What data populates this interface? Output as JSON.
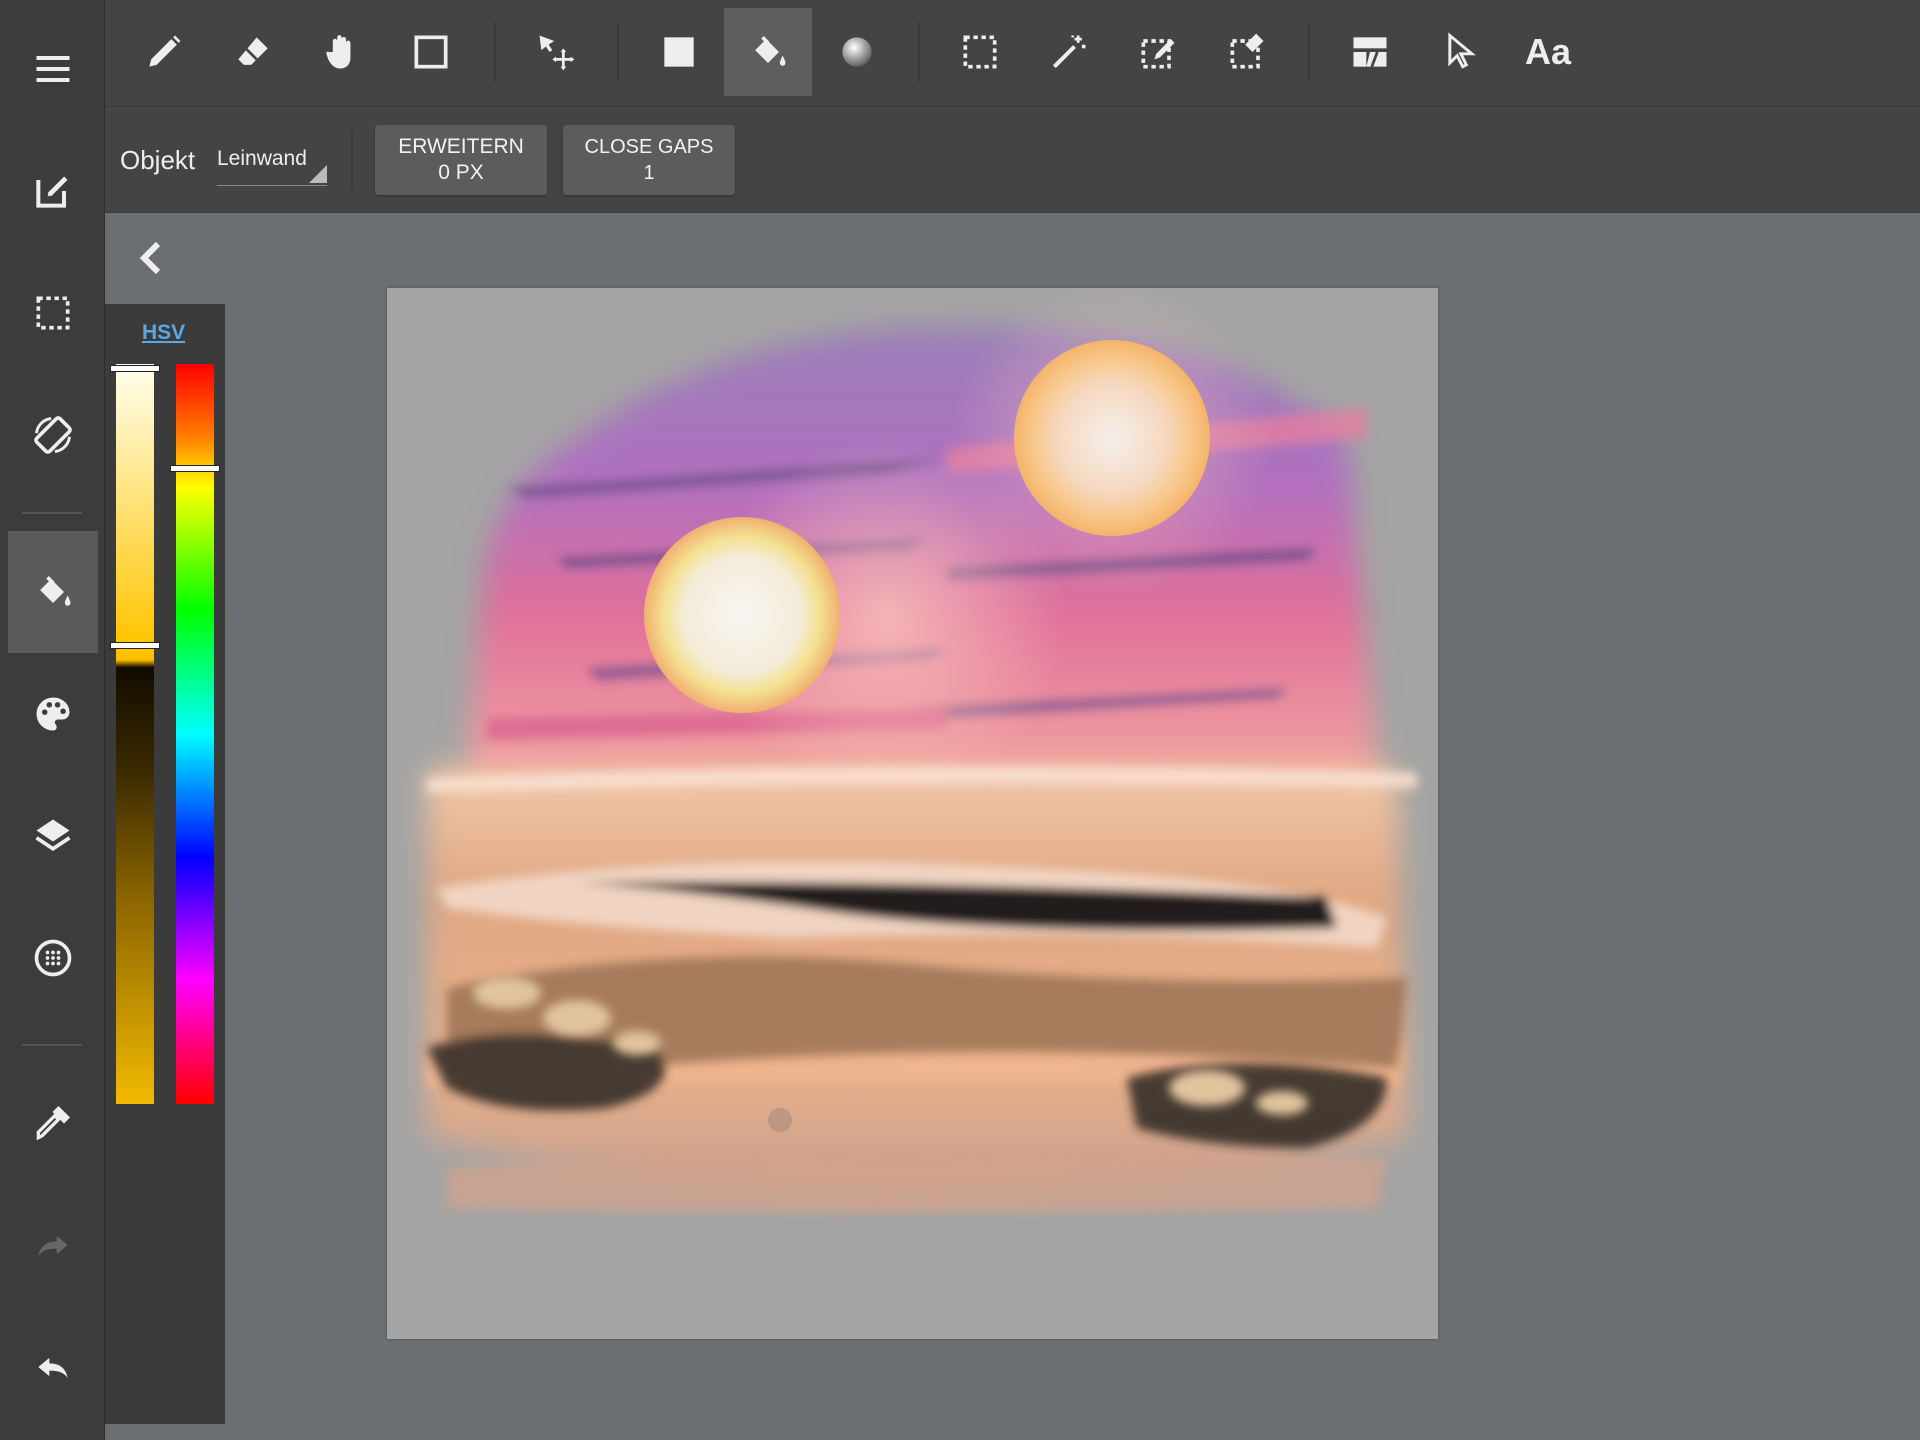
{
  "app": {
    "accent_color": "#5aa8e8",
    "active_tool_bg": "#5e5e5e"
  },
  "sidebar": {
    "items": [
      {
        "name": "menu-icon"
      },
      {
        "name": "edit-icon"
      },
      {
        "name": "selection-icon"
      },
      {
        "name": "rotate-screen-icon"
      },
      {
        "name": "fill-bucket-icon",
        "active": true
      },
      {
        "name": "palette-icon"
      },
      {
        "name": "layers-icon"
      },
      {
        "name": "grid-icon"
      },
      {
        "name": "eyedropper-icon"
      },
      {
        "name": "redo-icon",
        "enabled": false
      },
      {
        "name": "undo-icon"
      }
    ]
  },
  "toolbar": {
    "tools": [
      "pencil-icon",
      "eraser-icon",
      "hand-icon",
      "square-icon",
      "move-icon",
      "filled-square-icon",
      "bucket-fill-icon",
      "gradient-circle-icon",
      "rect-select-icon",
      "magic-wand-icon",
      "select-pen-icon",
      "select-eraser-icon",
      "frame-icon",
      "pointer-icon",
      "text-icon"
    ],
    "active_tool": "bucket-fill-icon",
    "text_tool_label": "Aa"
  },
  "options": {
    "object_label": "Objekt",
    "object_value": "Leinwand",
    "expand_title": "ERWEITERN",
    "expand_value": "0 PX",
    "close_gaps_title": "CLOSE GAPS",
    "close_gaps_value": "1"
  },
  "color_panel": {
    "mode_label": "HSV",
    "value_level": 0.38,
    "hue_level": 0.14
  }
}
